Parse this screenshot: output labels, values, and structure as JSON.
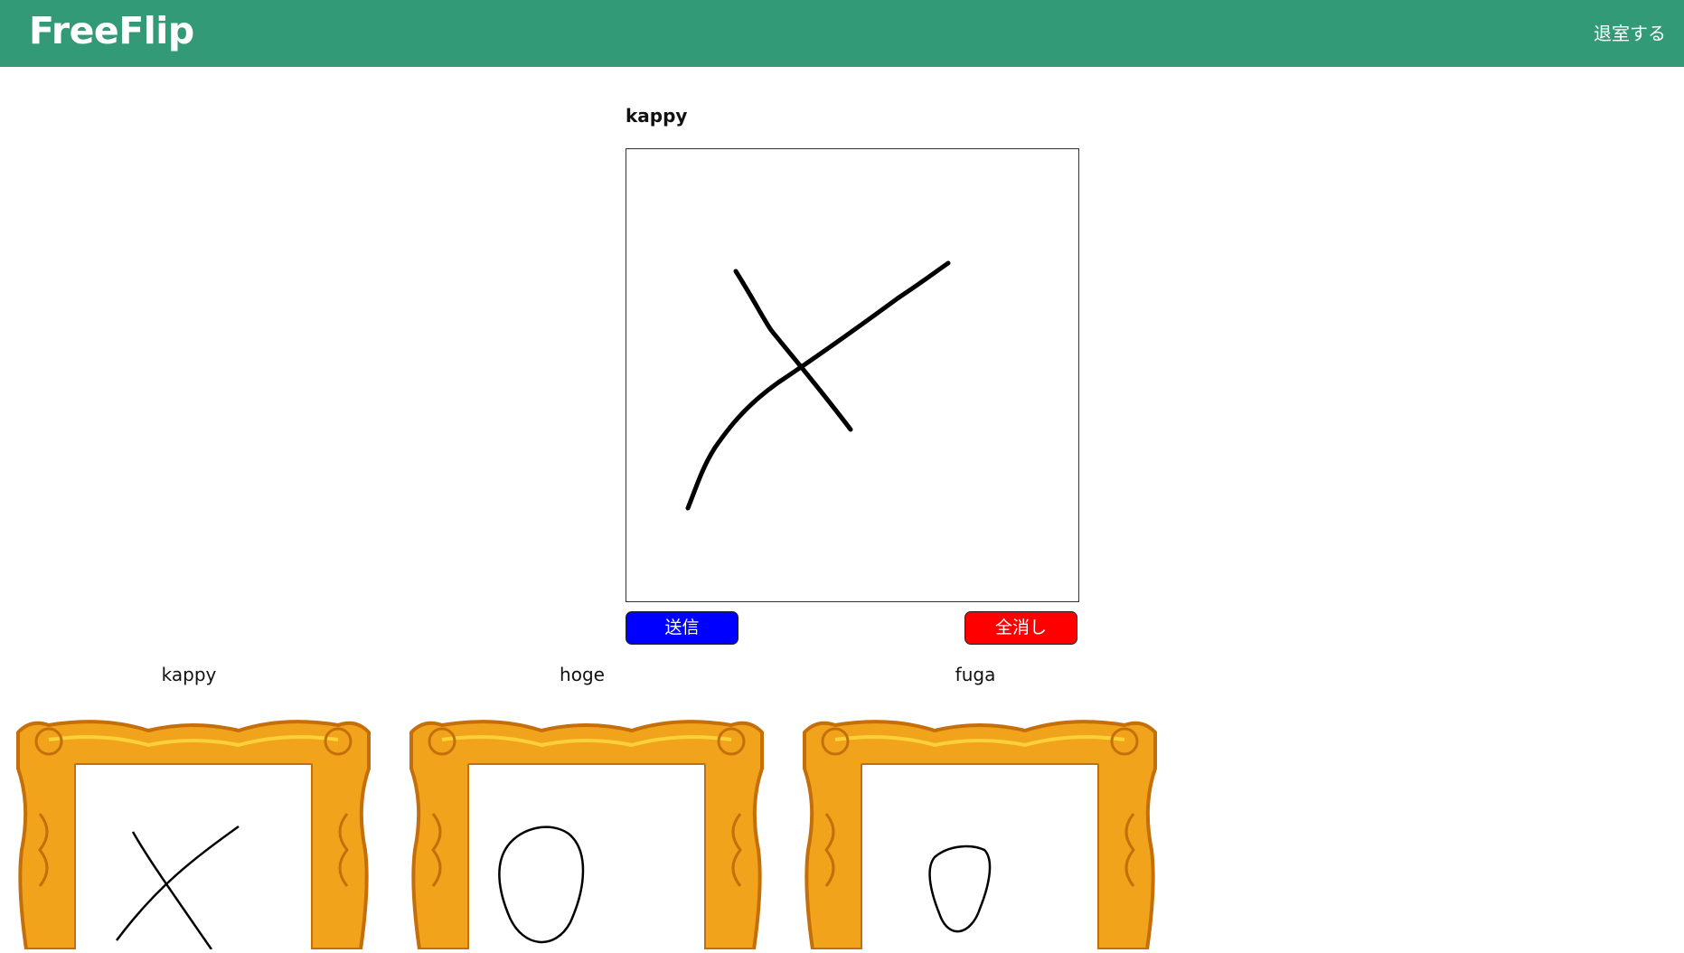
{
  "app": {
    "title": "FreeFlip"
  },
  "header": {
    "exit_label": "退室する"
  },
  "drawing": {
    "player_name": "kappy",
    "send_label": "送信",
    "clear_label": "全消し"
  },
  "gallery": [
    {
      "name": "kappy",
      "drawing": "x-mark"
    },
    {
      "name": "hoge",
      "drawing": "circle"
    },
    {
      "name": "fuga",
      "drawing": "circle"
    }
  ],
  "colors": {
    "header_bg": "#339a77",
    "send_bg": "#0000ff",
    "clear_bg": "#ff0000",
    "frame_gold": "#f1a31b"
  }
}
